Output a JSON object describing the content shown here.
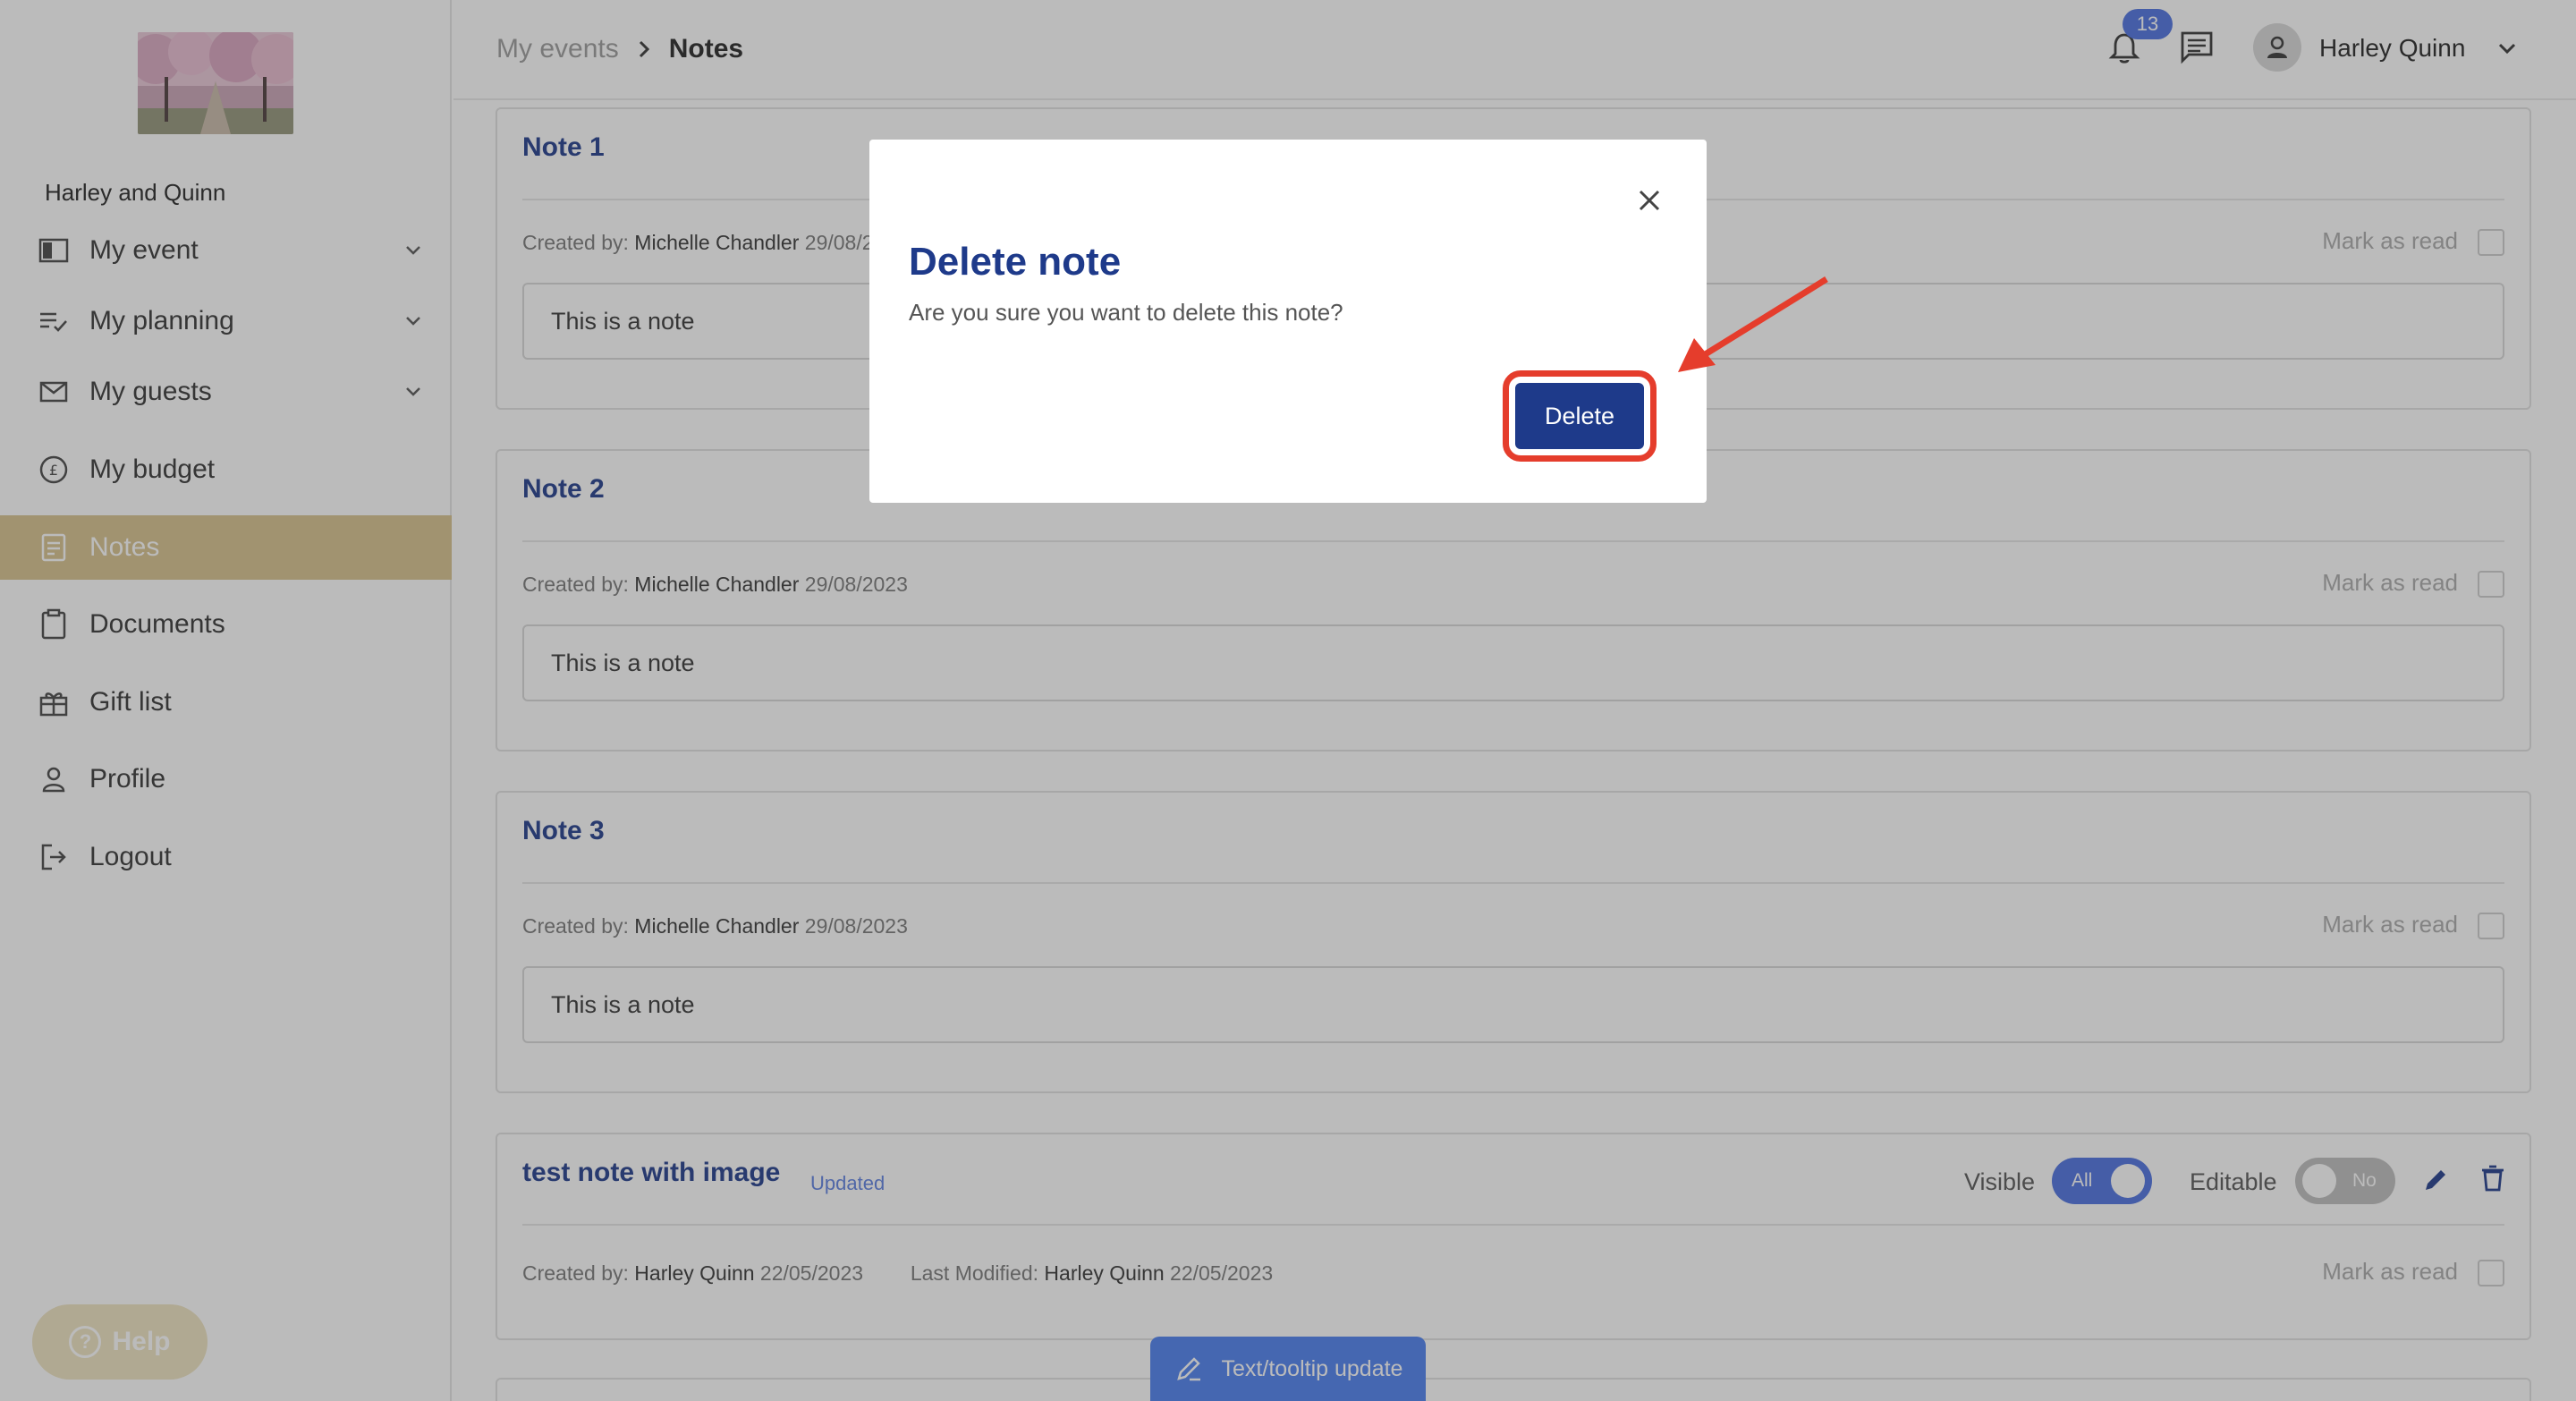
{
  "sidebar": {
    "event_name": "Harley and Quinn",
    "items": [
      {
        "label": "My event",
        "icon": "event-layout-icon",
        "expandable": true
      },
      {
        "label": "My planning",
        "icon": "checklist-icon",
        "expandable": true
      },
      {
        "label": "My guests",
        "icon": "mail-icon",
        "expandable": true
      },
      {
        "label": "My budget",
        "icon": "pound-coin-icon",
        "expandable": false
      },
      {
        "label": "Notes",
        "icon": "note-icon",
        "expandable": false,
        "active": true
      },
      {
        "label": "Documents",
        "icon": "clipboard-icon",
        "expandable": false
      },
      {
        "label": "Gift list",
        "icon": "gift-icon",
        "expandable": false
      },
      {
        "label": "Profile",
        "icon": "person-icon",
        "expandable": false
      },
      {
        "label": "Logout",
        "icon": "logout-icon",
        "expandable": false
      }
    ],
    "help_label": "Help"
  },
  "header": {
    "breadcrumb_parent": "My events",
    "breadcrumb_current": "Notes",
    "notification_count": "13",
    "user_name": "Harley Quinn"
  },
  "notes": [
    {
      "title": "Note 1",
      "created_label": "Created by:",
      "created_by": "Michelle Chandler",
      "created_date": "29/08/2023",
      "body": "This is a note",
      "mark_read_label": "Mark as read"
    },
    {
      "title": "Note 2",
      "created_label": "Created by:",
      "created_by": "Michelle Chandler",
      "created_date": "29/08/2023",
      "body": "This is a note",
      "mark_read_label": "Mark as read"
    },
    {
      "title": "Note 3",
      "created_label": "Created by:",
      "created_by": "Michelle Chandler",
      "created_date": "29/08/2023",
      "body": "This is a note",
      "mark_read_label": "Mark as read"
    },
    {
      "title": "test note with image",
      "tag": "Updated",
      "created_label": "Created by:",
      "created_by": "Harley Quinn",
      "created_date": "22/05/2023",
      "modified_label": "Last Modified:",
      "modified_by": "Harley Quinn",
      "modified_date": "22/05/2023",
      "mark_read_label": "Mark as read",
      "visible_label": "Visible",
      "visible_value": "All",
      "editable_label": "Editable",
      "editable_value": "No"
    }
  ],
  "tooltip_tab": {
    "label": "Text/tooltip update"
  },
  "modal": {
    "title": "Delete note",
    "message": "Are you sure you want to delete this note?",
    "delete_label": "Delete"
  },
  "colors": {
    "accent": "#1e3a8a",
    "sidebar_active": "#d8c28c",
    "highlight": "#e53d2c",
    "toggle_on": "#4a6fe0"
  }
}
